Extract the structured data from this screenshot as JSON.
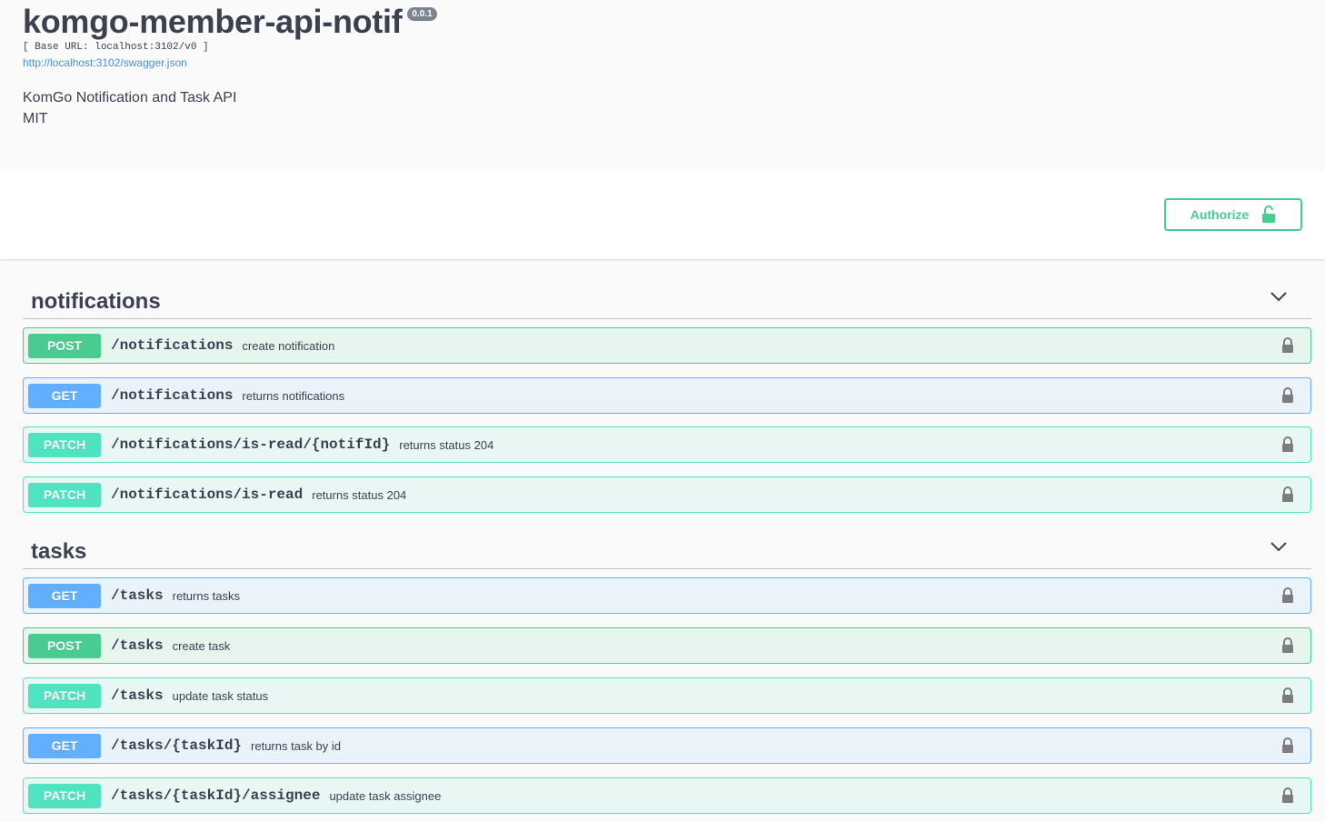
{
  "info": {
    "title": "komgo-member-api-notif",
    "version": "0.0.1",
    "base_url": "[ Base URL: localhost:3102/v0 ]",
    "spec_link": "http://localhost:3102/swagger.json",
    "description": "KomGo Notification and Task API",
    "license": "MIT"
  },
  "authorize": {
    "label": "Authorize"
  },
  "colors": {
    "post": "#49cc90",
    "get": "#61affe",
    "patch": "#50e3c2",
    "text": "#3b4151",
    "link": "#4990e2"
  },
  "sections": [
    {
      "name": "notifications",
      "operations": [
        {
          "method": "POST",
          "path": "/notifications",
          "summary": "create notification"
        },
        {
          "method": "GET",
          "path": "/notifications",
          "summary": "returns notifications"
        },
        {
          "method": "PATCH",
          "path": "/notifications/is-read/{notifId}",
          "summary": "returns status 204"
        },
        {
          "method": "PATCH",
          "path": "/notifications/is-read",
          "summary": "returns status 204"
        }
      ]
    },
    {
      "name": "tasks",
      "operations": [
        {
          "method": "GET",
          "path": "/tasks",
          "summary": "returns tasks"
        },
        {
          "method": "POST",
          "path": "/tasks",
          "summary": "create task"
        },
        {
          "method": "PATCH",
          "path": "/tasks",
          "summary": "update task status"
        },
        {
          "method": "GET",
          "path": "/tasks/{taskId}",
          "summary": "returns task by id"
        },
        {
          "method": "PATCH",
          "path": "/tasks/{taskId}/assignee",
          "summary": "update task assignee"
        }
      ]
    }
  ]
}
